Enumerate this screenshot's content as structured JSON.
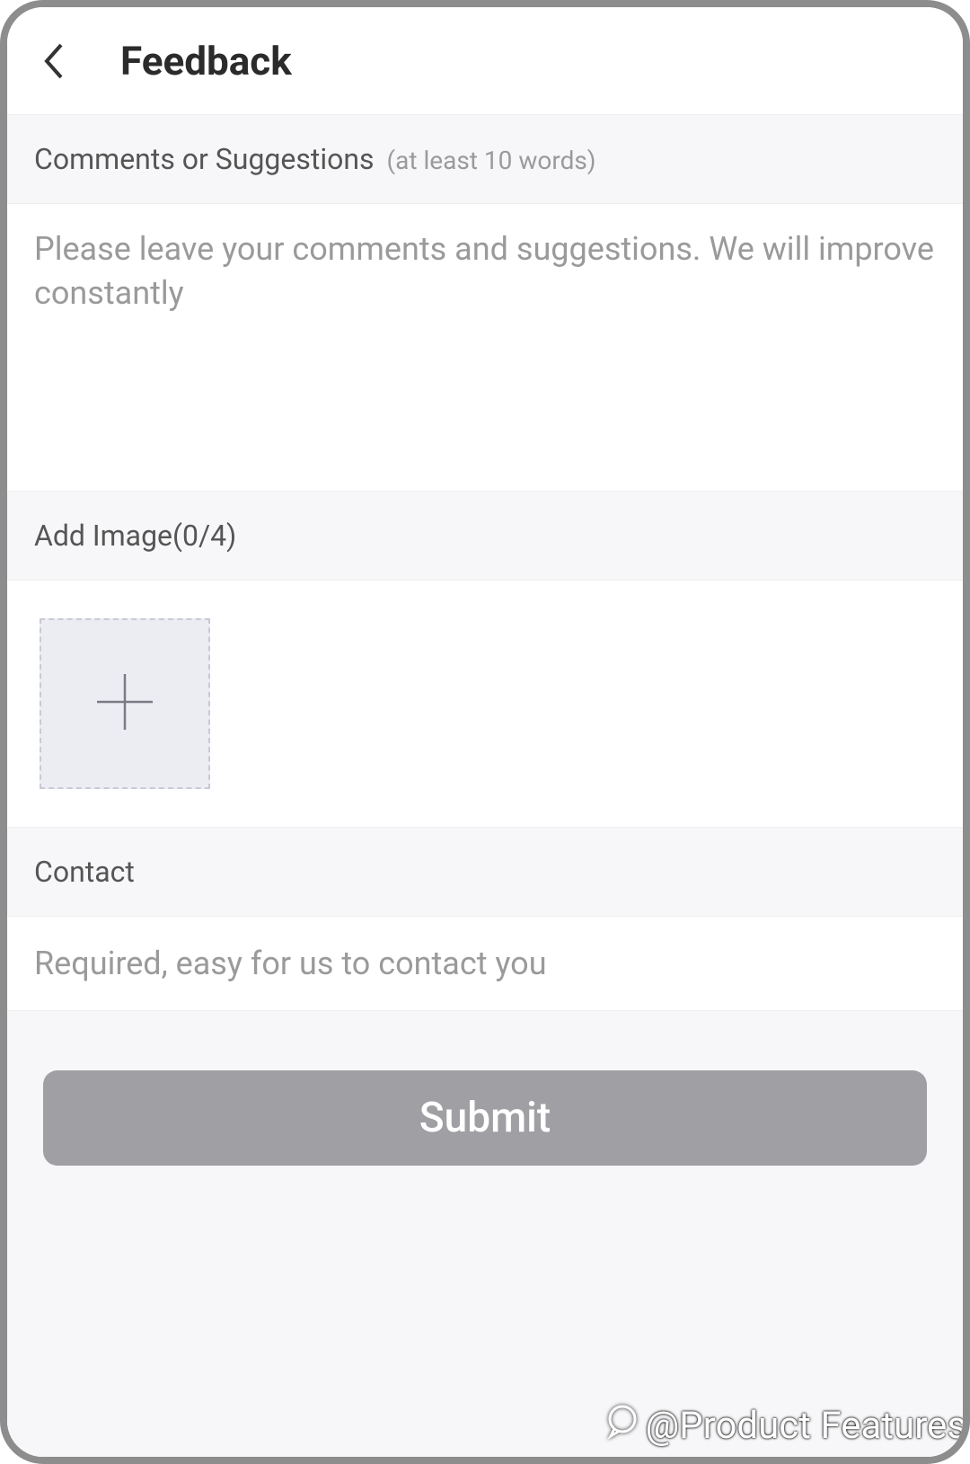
{
  "header": {
    "title": "Feedback"
  },
  "comments_section": {
    "label": "Comments or Suggestions",
    "hint": "(at least 10 words)",
    "placeholder": "Please leave your comments and suggestions. We will improve constantly",
    "value": ""
  },
  "images_section": {
    "label": "Add Image(0/4)",
    "current_count": 0,
    "max_count": 4
  },
  "contact_section": {
    "label": "Contact",
    "placeholder": "Required, easy for us to contact you",
    "value": ""
  },
  "submit": {
    "label": "Submit"
  },
  "watermark": {
    "text": "@Product Features"
  }
}
